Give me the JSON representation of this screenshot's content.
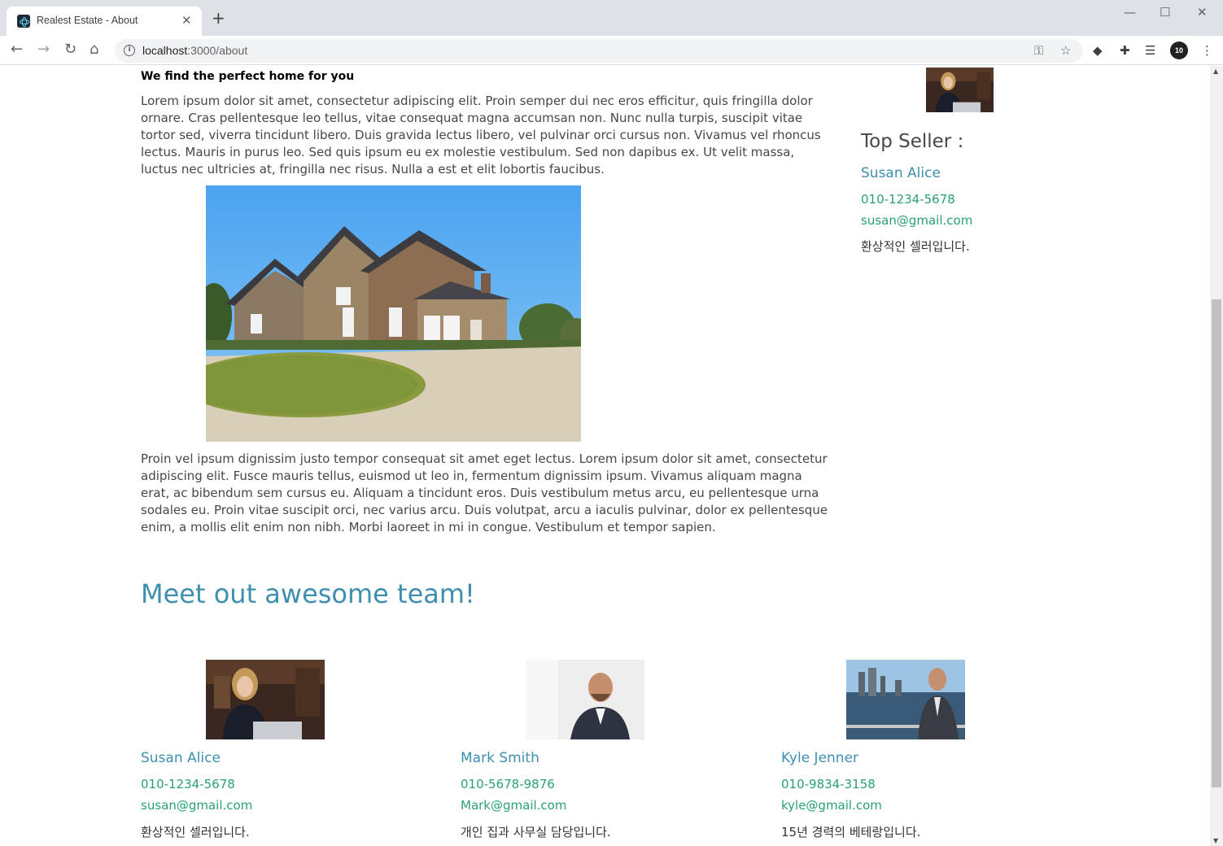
{
  "browser": {
    "tab_title": "Realest Estate - About",
    "tab_close": "✕",
    "new_tab": "+",
    "url_host": "localhost",
    "url_rest": ":3000/about",
    "profile_label": "10",
    "window_controls": [
      "—",
      "☐",
      "✕"
    ]
  },
  "content": {
    "heading": "We find the perfect home for you",
    "paragraph1": "Lorem ipsum dolor sit amet, consectetur adipiscing elit. Proin semper dui nec eros efficitur, quis fringilla dolor ornare. Cras pellentesque leo tellus, vitae consequat magna accumsan non. Nunc nulla turpis, suscipit vitae tortor sed, viverra tincidunt libero. Duis gravida lectus libero, vel pulvinar orci cursus non. Vivamus vel rhoncus lectus. Mauris in purus leo. Sed quis ipsum eu ex molestie vestibulum. Sed non dapibus ex. Ut velit massa, luctus nec ultricies at, fringilla nec risus. Nulla a est et elit lobortis faucibus.",
    "paragraph2": "Proin vel ipsum dignissim justo tempor consequat sit amet eget lectus. Lorem ipsum dolor sit amet, consectetur adipiscing elit. Fusce mauris tellus, euismod ut leo in, fermentum dignissim ipsum. Vivamus aliquam magna erat, ac bibendum sem cursus eu. Aliquam a tincidunt eros. Duis vestibulum metus arcu, eu pellentesque urna sodales eu. Proin vitae suscipit orci, nec varius arcu. Duis volutpat, arcu a iaculis pulvinar, dolor ex pellentesque enim, a mollis elit enim non nibh. Morbi laoreet in mi in congue. Vestibulum et tempor sapien."
  },
  "top_seller": {
    "title": "Top Seller :",
    "name": "Susan Alice",
    "phone": "010-1234-5678",
    "email": "susan@gmail.com",
    "description": "환상적인 셀러입니다."
  },
  "team": {
    "title": "Meet out awesome team!",
    "members": [
      {
        "name": "Susan Alice",
        "phone": "010-1234-5678",
        "email": "susan@gmail.com",
        "description": "환상적인 셀러입니다."
      },
      {
        "name": "Mark Smith",
        "phone": "010-5678-9876",
        "email": "Mark@gmail.com",
        "description": "개인 집과 사무실 담당입니다."
      },
      {
        "name": "Kyle Jenner",
        "phone": "010-9834-3158",
        "email": "kyle@gmail.com",
        "description": "15년 경력의 베테랑입니다."
      }
    ]
  },
  "colors": {
    "link_blue": "#3e8fb0",
    "contact_green": "#2aa07a",
    "body_text": "#474747"
  }
}
